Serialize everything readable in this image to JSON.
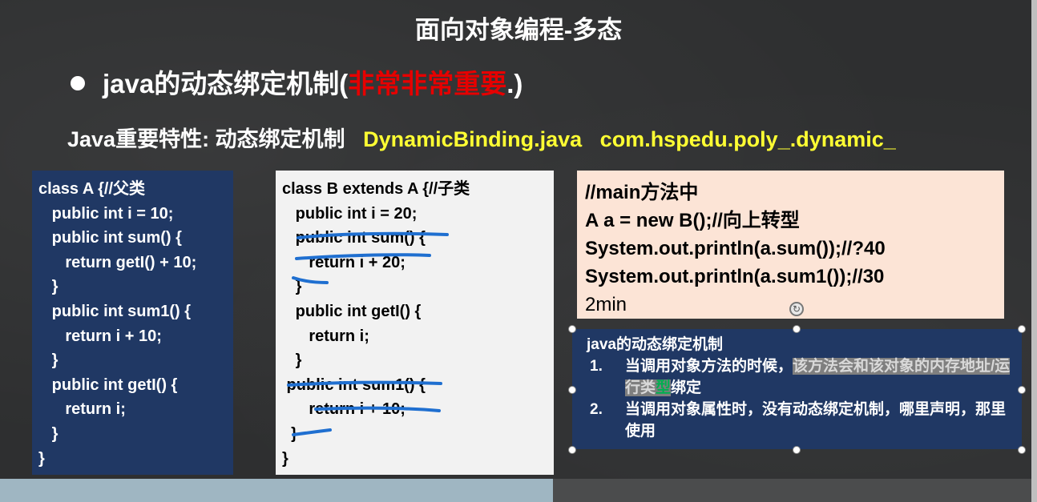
{
  "slide": {
    "title": "面向对象编程-多态",
    "bullet": {
      "prefix": "java的动态绑定机制(",
      "emphasis": "非常非常重要",
      "suffix": ".)"
    },
    "feature": {
      "label": "Java重要特性: 动态绑定机制",
      "file": "DynamicBinding.java",
      "package": "com.hspedu.poly_.dynamic_"
    }
  },
  "class_a": {
    "lines": [
      "class A {//父类",
      "   public int i = 10;",
      "   public int sum() {",
      "      return getI() + 10;",
      "   }",
      "   public int sum1() {",
      "      return i + 10;",
      "   }",
      "   public int getI() {",
      "      return i;",
      "   }",
      "}"
    ]
  },
  "class_b": {
    "lines": [
      "class B extends A {//子类",
      "   public int i = 20;",
      "   public int sum() {",
      "      return i + 20;",
      "   }",
      "   public int getI() {",
      "      return i;",
      "   }",
      " public int sum1() {",
      "      return i + 10;",
      "  }",
      "}"
    ]
  },
  "main_box": {
    "lines": [
      "//main方法中",
      "A a = new B();//向上转型",
      "System.out.println(a.sum());//?40",
      "System.out.println(a.sum1());//30",
      "2min"
    ]
  },
  "rules": {
    "title": "java的动态绑定机制",
    "item1": {
      "num": "1.",
      "part1": "当调用对象方法的时候，",
      "highlight1": "该方法会和该对象的内存地址/运行类",
      "green": "型",
      "part2": "绑定"
    },
    "item2": {
      "num": "2.",
      "text": "当调用对象属性时，没有动态绑定机制，哪里声明，那里使用"
    }
  },
  "colors": {
    "background": "#2e2f30",
    "box_a": "#203864",
    "box_b": "#f2f2f2",
    "main_box": "#fce4d6",
    "emphasis_red": "#e60000",
    "yellow": "#ffff33",
    "pen_blue": "#1f6fd0"
  }
}
